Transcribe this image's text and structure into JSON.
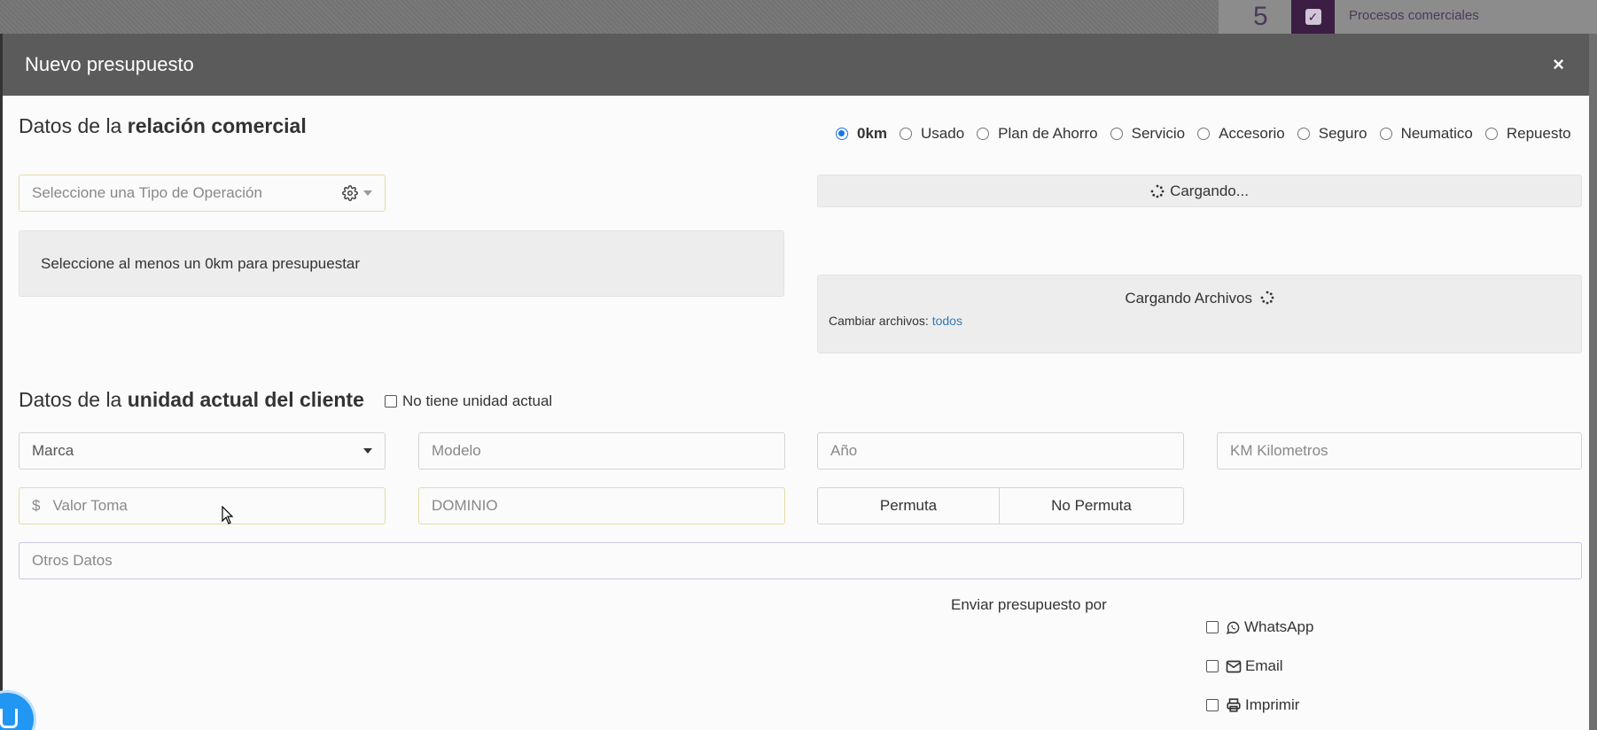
{
  "background": {
    "count": "5",
    "item_label": "Procesos comerciales"
  },
  "modal": {
    "title": "Nuevo presupuesto",
    "close": "×"
  },
  "relacion": {
    "title_prefix": "Datos de la ",
    "title_bold": "relación comercial",
    "options": [
      {
        "label": "0km",
        "checked": true
      },
      {
        "label": "Usado",
        "checked": false
      },
      {
        "label": "Plan de Ahorro",
        "checked": false
      },
      {
        "label": "Servicio",
        "checked": false
      },
      {
        "label": "Accesorio",
        "checked": false
      },
      {
        "label": "Seguro",
        "checked": false
      },
      {
        "label": "Neumatico",
        "checked": false
      },
      {
        "label": "Repuesto",
        "checked": false
      }
    ],
    "tipo_operacion_placeholder": "Seleccione una Tipo de Operación",
    "loading_text": "Cargando...",
    "info_text": "Seleccione al menos un 0km para presupuestar",
    "archivos_loading": "Cargando Archivos",
    "cambiar_label": "Cambiar archivos:",
    "cambiar_link": "todos"
  },
  "unidad": {
    "title_prefix": "Datos de la ",
    "title_bold": "unidad actual del cliente",
    "no_unit_label": "No tiene unidad actual",
    "marca_value": "Marca",
    "modelo_placeholder": "Modelo",
    "anio_placeholder": "Año",
    "km_placeholder": "KM Kilometros",
    "currency_symbol": "$",
    "valor_placeholder": "Valor Toma",
    "dominio_placeholder": "DOMINIO",
    "permuta_label": "Permuta",
    "no_permuta_label": "No Permuta",
    "otros_placeholder": "Otros Datos"
  },
  "envio": {
    "title": "Enviar presupuesto por",
    "options": [
      "WhatsApp",
      "Email",
      "Imprimir"
    ]
  },
  "colors": {
    "header_bg": "#5b5b5b",
    "accent_blue": "#1a73e8",
    "link_blue": "#337ab7"
  }
}
